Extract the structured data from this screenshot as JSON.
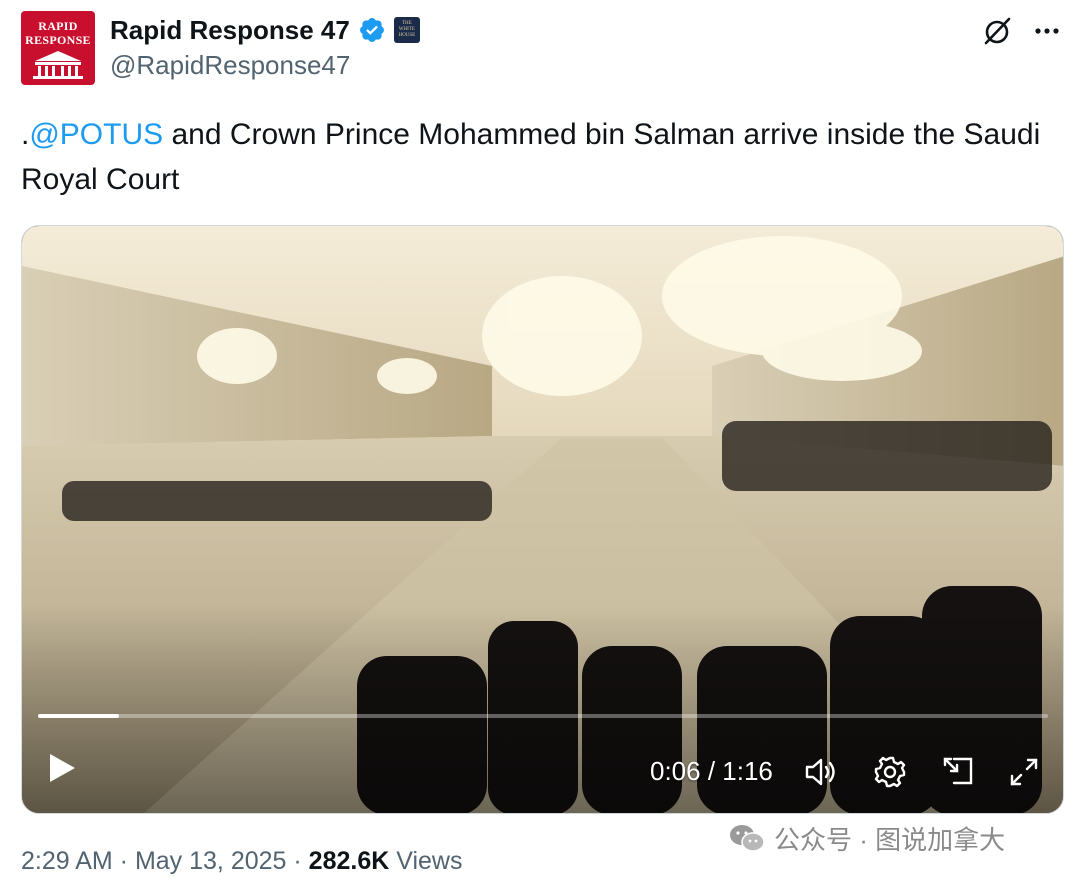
{
  "account": {
    "display_name": "Rapid Response 47",
    "handle": "@RapidResponse47",
    "avatar_text_line1": "RAPID",
    "avatar_text_line2": "RESPONSE",
    "affiliate_badge_text": "THE WHITE HOUSE",
    "verified_color": "#1d9bf0"
  },
  "header_icons": {
    "grok": "grok-icon",
    "more": "more-icon"
  },
  "tweet": {
    "prefix": ".",
    "mention": "@POTUS",
    "body": " and Crown Prince Mohammed bin Salman arrive inside the Saudi Royal Court"
  },
  "video": {
    "current_time": "0:06",
    "separator": " / ",
    "duration": "1:16",
    "progress_fraction": 0.08,
    "controls": [
      "play-icon",
      "volume-icon",
      "settings-icon",
      "pip-icon",
      "fullscreen-icon"
    ]
  },
  "meta": {
    "time": "2:29 AM",
    "dot1": " · ",
    "date": "May 13, 2025",
    "dot2": " · ",
    "views_count": "282.6K",
    "views_label": " Views"
  },
  "watermark": {
    "text": "公众号 · 图说加拿大"
  },
  "colors": {
    "link": "#1d9bf0",
    "secondary_text": "#536471",
    "primary_text": "#0f1419",
    "avatar_red": "#c8102e"
  }
}
